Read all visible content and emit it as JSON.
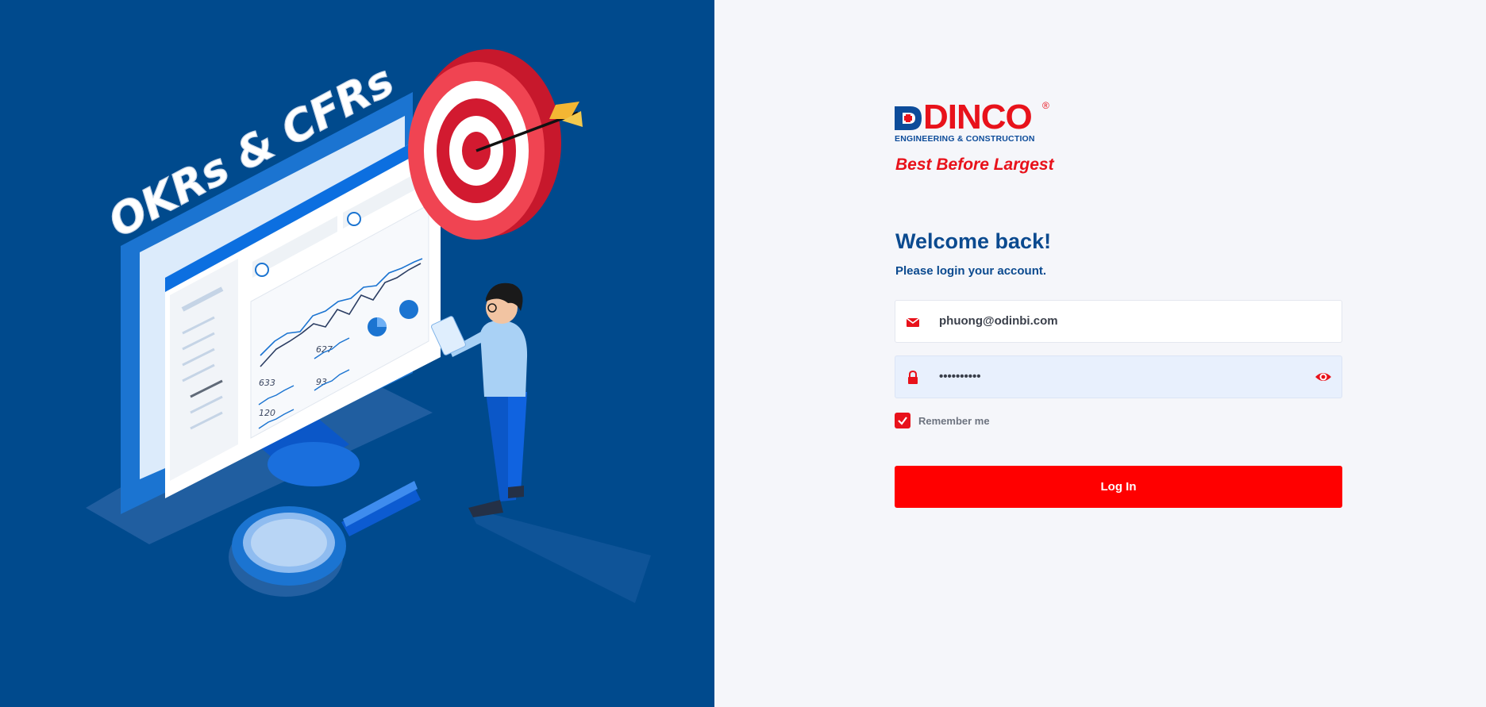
{
  "hero": {
    "headline": "OKRs & CFRs",
    "chart_labels": [
      "633",
      "627",
      "93",
      "120"
    ]
  },
  "brand": {
    "name": "DINCO",
    "registered": "®",
    "subtitle": "ENGINEERING & CONSTRUCTION",
    "tagline": "Best Before Largest",
    "accent_color": "#e8121b",
    "primary_color": "#0b4a8f"
  },
  "login": {
    "title": "Welcome back!",
    "subtitle": "Please login your account.",
    "email_value": "phuong@odinbi.com",
    "password_value": "••••••••••",
    "remember_label": "Remember me",
    "remember_checked": true,
    "submit_label": "Log In",
    "icons": {
      "email": "envelope-icon",
      "password": "lock-icon",
      "toggle": "eye-icon",
      "checkbox": "check-icon"
    }
  }
}
